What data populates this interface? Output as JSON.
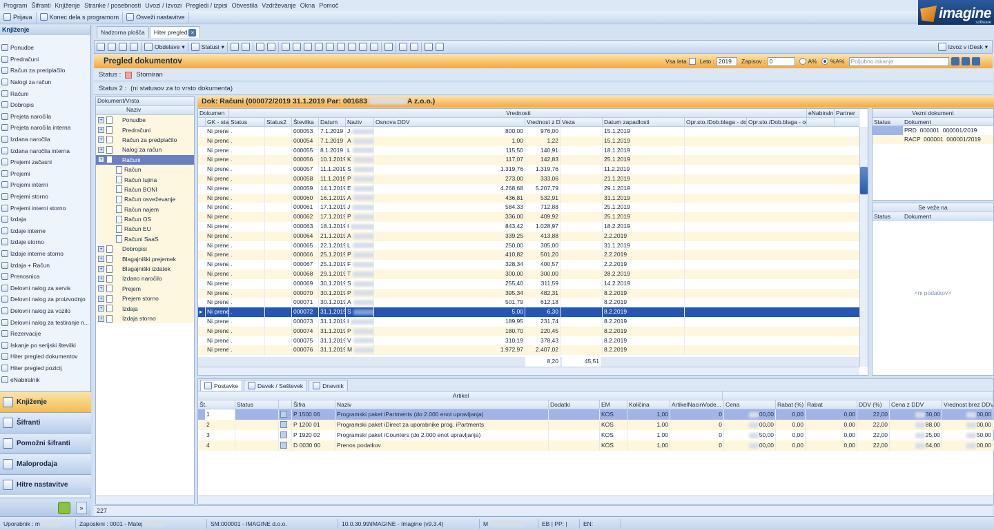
{
  "menu": [
    "Program",
    "Šifranti",
    "Knjiženje",
    "Stranke / posebnosti",
    "Uvozi / Izvozi",
    "Pregledi / izpisi",
    "Obvestila",
    "Vzdrževanje",
    "Okna",
    "Pomoč"
  ],
  "toolbar1": [
    "Prijava",
    "Konec dela s programom",
    "Osveži nastavitve"
  ],
  "logo": {
    "text": "imagine",
    "sub": "software"
  },
  "left": {
    "title": "Knjiženje",
    "items": [
      "Ponudbe",
      "Predračuni",
      "Račun za predplačilo",
      "Nalogi za račun",
      "Računi",
      "Dobropis",
      "Prejeta naročila",
      "Prejeta naročila interna",
      "Izdana naročila",
      "Izdana naročila interna",
      "Prejemi začasni",
      "Prejemi",
      "Prejemi interni",
      "Prejemi storno",
      "Prejemi interni storno",
      "Izdaja",
      "Izdaje interne",
      "Izdaje storno",
      "Izdaje interne storno",
      "Izdaja + Račun",
      "Prenosnica",
      "Delovni nalog za servis",
      "Delovni nalog za proizvodnjo",
      "Delovni nalog za vozilo",
      "Delovni nalog za testiranje n...",
      "Rezervacije",
      "Iskanje po serijski številki",
      "Hiter pregled dokumentov",
      "Hiter pregled pozicij",
      "eNabiralnik"
    ],
    "nav": [
      "Knjiženje",
      "Šifranti",
      "Pomožni šifranti",
      "Maloprodaja",
      "Hitre nastavitve"
    ]
  },
  "tabs": [
    "Nadzorna plošča",
    "Hiter pregled"
  ],
  "toolbar2": {
    "obdelave": "Obdelave",
    "statusi": "Statusi",
    "export": "Izvoz v iDesk"
  },
  "title": "Pregled dokumentov",
  "filters": {
    "vsa_leta": "Vsa leta",
    "leto_label": "Leto :",
    "leto": "2019",
    "zapisov_label": "Zapisov :",
    "zapisov": "0",
    "a": "A%",
    "pa": "%A%",
    "search_placeholder": "Poljubno iskanje"
  },
  "status": {
    "label": "Status :",
    "value": "Storniran",
    "label2": "Status 2 :",
    "value2": "(ni statusov za to vrsto dokumenta)"
  },
  "tree": {
    "h1": "Dokument/Vrsta",
    "h2": "Naziv",
    "items": [
      {
        "t": "Ponudbe",
        "s": 0
      },
      {
        "t": "Predračuni",
        "s": 0
      },
      {
        "t": "Račun za predplačilo",
        "s": 0
      },
      {
        "t": "Nalog za račun",
        "s": 0
      },
      {
        "t": "Računi",
        "s": 0,
        "sel": 1
      },
      {
        "t": "Račun",
        "s": 1
      },
      {
        "t": "Račun tujina",
        "s": 1
      },
      {
        "t": "Račun BONI",
        "s": 1
      },
      {
        "t": "Račun osveževanje",
        "s": 1
      },
      {
        "t": "Račun najem",
        "s": 1
      },
      {
        "t": "Račun OS",
        "s": 1
      },
      {
        "t": "Račun EU",
        "s": 1
      },
      {
        "t": "Računi SaaS",
        "s": 1
      },
      {
        "t": "Dobropisi",
        "s": 0
      },
      {
        "t": "Blagajniški prejemek",
        "s": 0
      },
      {
        "t": "Blagajniški izdatek",
        "s": 0
      },
      {
        "t": "Izdano naročilo",
        "s": 0
      },
      {
        "t": "Prejem",
        "s": 0
      },
      {
        "t": "Prejem storno",
        "s": 0
      },
      {
        "t": "Izdaja",
        "s": 0
      },
      {
        "t": "Izdaja storno",
        "s": 0
      }
    ]
  },
  "dok_header": "Dok: Računi (000072/2019 31.1.2019  Par: 001683",
  "dok_header_tail": "A z.o.o.)",
  "grid": {
    "band1": "Dokumen",
    "band2": "Vrednosti",
    "band3": "eNabiraln",
    "band4": "Partner",
    "cols": [
      "GK - status",
      "Status",
      "Status2",
      "Številka",
      "Datum",
      "Naziv",
      "Osnova DDV",
      "Vrednost z DDV",
      "Veza",
      "Datum zapadlosti",
      "Opr.sto./Dob.blaga - do",
      "Opr.sto./Dob.blaga - od"
    ],
    "rows": [
      [
        "Ni prenešeno",
        ".",
        "",
        "000053",
        "7.1.2019",
        "J",
        "800,00",
        "976,00",
        "",
        "15.1.2019"
      ],
      [
        "Ni prenešeno",
        ".",
        "",
        "000054",
        "7.1.2019",
        "A",
        "1,00",
        "1,22",
        "",
        "15.1.2019"
      ],
      [
        "Ni prenešeno",
        ".",
        "",
        "000055",
        "8.1.2019",
        "L",
        "115,50",
        "140,91",
        "",
        "18.1.2019"
      ],
      [
        "Ni prenešeno",
        ".",
        "",
        "000056",
        "10.1.2019",
        "K",
        "117,07",
        "142,83",
        "",
        "25.1.2019"
      ],
      [
        "Ni prenešeno",
        ".",
        "",
        "000057",
        "11.1.2019",
        "S",
        "1.319,76",
        "1.319,76",
        "",
        "11.2.2019"
      ],
      [
        "Ni prenešeno",
        ".",
        "",
        "000058",
        "11.1.2019",
        "P",
        "273,00",
        "333,06",
        "",
        "21.1.2019"
      ],
      [
        "Ni prenešeno",
        ".",
        "",
        "000059",
        "14.1.2019",
        "E",
        "4.268,68",
        "5.207,79",
        "",
        "29.1.2019"
      ],
      [
        "Ni prenešeno",
        ".",
        "",
        "000060",
        "16.1.2019",
        "A",
        "436,81",
        "532,91",
        "",
        "31.1.2019"
      ],
      [
        "Ni prenešeno",
        ".",
        "",
        "000061",
        "17.1.2019",
        "J",
        "584,33",
        "712,88",
        "",
        "25.1.2019"
      ],
      [
        "Ni prenešeno",
        ".",
        "",
        "000062",
        "17.1.2019",
        "P",
        "336,00",
        "409,92",
        "",
        "25.1.2019"
      ],
      [
        "Ni prenešeno",
        ".",
        "",
        "000063",
        "18.1.2019",
        "I",
        "843,42",
        "1.028,97",
        "",
        "18.2.2019"
      ],
      [
        "Ni prenešeno",
        ".",
        "",
        "000064",
        "21.1.2019",
        "A",
        "339,25",
        "413,88",
        "",
        "2.2.2019"
      ],
      [
        "Ni prenešeno",
        ".",
        "",
        "000065",
        "22.1.2019",
        "L",
        "250,00",
        "305,00",
        "",
        "31.1.2019"
      ],
      [
        "Ni prenešeno",
        ".",
        "",
        "000066",
        "25.1.2019",
        "P",
        "410,82",
        "501,20",
        "",
        "2.2.2019"
      ],
      [
        "Ni prenešeno",
        ".",
        "",
        "000067",
        "25.1.2019",
        "F",
        "328,34",
        "400,57",
        "",
        "2.2.2019"
      ],
      [
        "Ni prenešeno",
        ".",
        "",
        "000068",
        "29.1.2019",
        "T",
        "300,00",
        "300,00",
        "",
        "28.2.2019"
      ],
      [
        "Ni prenešeno",
        ".",
        "",
        "000069",
        "30.1.2019",
        "S",
        "255,40",
        "311,59",
        "",
        "14.2.2019"
      ],
      [
        "Ni prenešeno",
        ".",
        "",
        "000070",
        "30.1.2019",
        "P",
        "395,34",
        "482,31",
        "",
        "8.2.2019"
      ],
      [
        "Ni prenešeno",
        ".",
        "",
        "000071",
        "30.1.2019",
        "A",
        "501,79",
        "612,18",
        "",
        "8.2.2019"
      ],
      [
        "Ni prenešeno",
        ".",
        "",
        "000072",
        "31.1.2019",
        "S",
        "5,00",
        "6,30",
        "",
        "8.2.2019"
      ],
      [
        "Ni prenešeno",
        ".",
        "",
        "000073",
        "31.1.2019",
        "I",
        "189,95",
        "231,74",
        "",
        "8.2.2019"
      ],
      [
        "Ni prenešeno",
        ".",
        "",
        "000074",
        "31.1.2019",
        "P",
        "180,70",
        "220,45",
        "",
        "8.2.2019"
      ],
      [
        "Ni prenešeno",
        ".",
        "",
        "000075",
        "31.1.2019",
        "V",
        "310,19",
        "378,43",
        "",
        "8.2.2019"
      ],
      [
        "Ni prenešeno",
        ".",
        "",
        "000076",
        "31.1.2019",
        "M",
        "1.972,97",
        "2.407,02",
        "",
        "8.2.2019"
      ]
    ],
    "sum1": "8,20",
    "sum2": "45,51"
  },
  "vezni": {
    "title": "Vezni dokument",
    "c1": "Status",
    "c2": "Dokument",
    "rows": [
      "PRD  000001  000001/2019",
      "RACP  000001  000001/2019"
    ]
  },
  "seveze": {
    "title": "Se veže na",
    "c1": "Status",
    "c2": "Dokument",
    "empty": "<ni podatkov>"
  },
  "btabs": [
    "Postavke",
    "Davek / Seštevek",
    "Dnevnik"
  ],
  "items": {
    "band": "Artikel",
    "cols": [
      "Št.",
      "Status",
      "",
      "Šifra",
      "Naziv",
      "Dodatki",
      "EM",
      "Količina",
      "ArtikelNacinVode...",
      "Cena",
      "Rabat (%)",
      "Rabat",
      "DDV (%)",
      "Cena z DDV",
      "Vrednost brez DDV"
    ],
    "rows": [
      [
        "1",
        "",
        "",
        "P 1500 06",
        "Programski paket iPartments (do 2.000 enot upravljanja)",
        "",
        "KOS",
        "1,00",
        "0",
        "00,00",
        "0,00",
        "0,00",
        "22,00",
        "30,00",
        "00,00"
      ],
      [
        "2",
        "",
        "",
        "P 1200 01",
        "Programski paket iDirect za uporabnike prog. iPartments",
        "",
        "KOS",
        "1,00",
        "0",
        "00,00",
        "0,00",
        "0,00",
        "22,00",
        "88,00",
        "00,00"
      ],
      [
        "3",
        "",
        "",
        "P 1920 02",
        "Programski paket iCounters (do 2.000 enot upravljanja)",
        "",
        "KOS",
        "1,00",
        "0",
        "50,00",
        "0,00",
        "0,00",
        "22,00",
        "25,00",
        "50,00"
      ],
      [
        "4",
        "",
        "",
        "D 0030 00",
        "Prenos podatkov",
        "",
        "KOS",
        "1,00",
        "0",
        "00,00",
        "0,00",
        "0,00",
        "22,00",
        "64,00",
        "00,00"
      ]
    ]
  },
  "footer_count": "227",
  "statusbar": [
    "Uporabnik : m",
    "Zaposleni : 0001 - Matej",
    "SM:000001 - IMAGINE d.o.o.",
    "10.0.30.99\\IMAGINE - Imagine (v9.3.4)",
    "M",
    "EB | PP: |",
    "EN:"
  ]
}
